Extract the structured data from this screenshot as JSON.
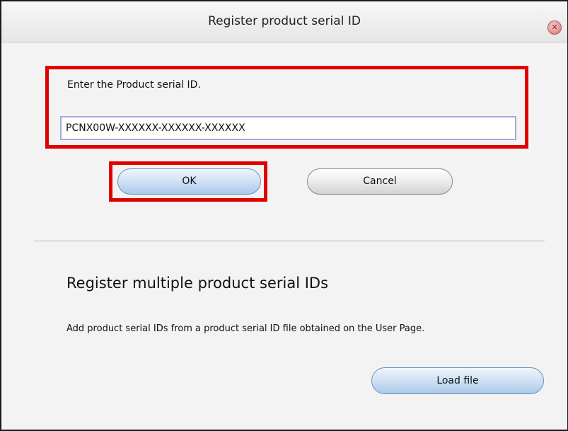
{
  "window": {
    "title": "Register product serial ID",
    "close_icon": "close-icon"
  },
  "serial_entry": {
    "prompt": "Enter the Product serial ID.",
    "value": "PCNX00W-XXXXXX-XXXXXX-XXXXXX",
    "highlight_color": "#e00000"
  },
  "buttons": {
    "ok_label": "OK",
    "cancel_label": "Cancel"
  },
  "multiple": {
    "heading": "Register multiple product serial IDs",
    "description": "Add product serial IDs from a product serial ID file obtained on the User Page.",
    "load_label": "Load file"
  }
}
